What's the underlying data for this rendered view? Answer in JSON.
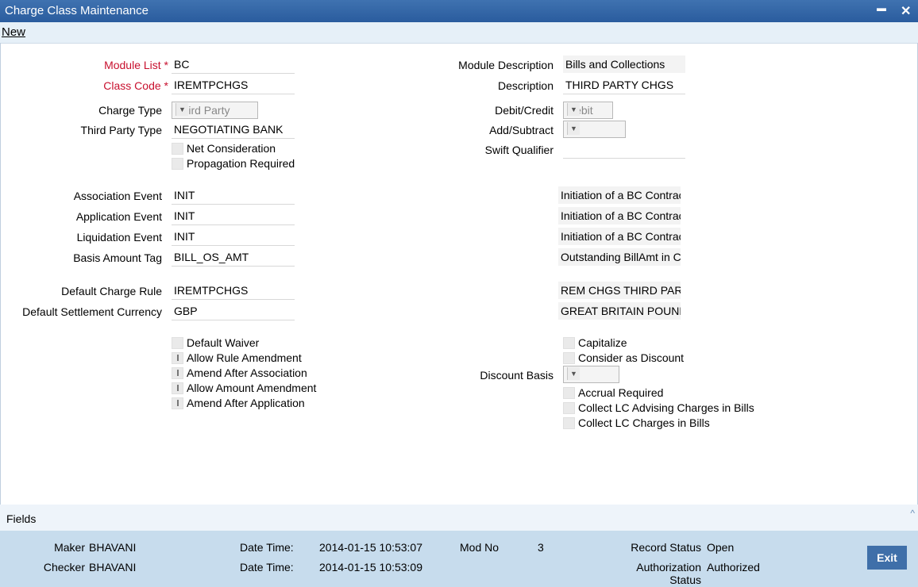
{
  "window": {
    "title": "Charge Class Maintenance",
    "minimize": "▬",
    "close": "✕"
  },
  "menu": {
    "new_label": "New"
  },
  "left": {
    "module_list": {
      "label": "Module List",
      "req": "*",
      "value": "BC"
    },
    "class_code": {
      "label": "Class Code",
      "req": "*",
      "value": "IREMTPCHGS"
    },
    "charge_type": {
      "label": "Charge Type",
      "value": "Third Party"
    },
    "third_party_type": {
      "label": "Third Party Type",
      "value": "NEGOTIATING BANK"
    },
    "net_consideration": "Net Consideration",
    "propagation_required": "Propagation Required",
    "association_event": {
      "label": "Association Event",
      "value": "INIT"
    },
    "application_event": {
      "label": "Application Event",
      "value": "INIT"
    },
    "liquidation_event": {
      "label": "Liquidation Event",
      "value": "INIT"
    },
    "basis_amount_tag": {
      "label": "Basis Amount Tag",
      "value": "BILL_OS_AMT"
    },
    "default_charge_rule": {
      "label": "Default Charge Rule",
      "value": "IREMTPCHGS"
    },
    "default_settlement_currency": {
      "label": "Default Settlement Currency",
      "value": "GBP"
    },
    "default_waiver": "Default Waiver",
    "allow_rule_amendment": "Allow Rule Amendment",
    "amend_after_association": "Amend After Association",
    "allow_amount_amendment": "Allow Amount Amendment",
    "amend_after_application": "Amend After Application"
  },
  "right": {
    "module_description": {
      "label": "Module Description",
      "value": "Bills and Collections"
    },
    "description": {
      "label": "Description",
      "value": "THIRD PARTY CHGS"
    },
    "debit_credit": {
      "label": "Debit/Credit",
      "value": "Debit"
    },
    "add_subtract": {
      "label": "Add/Subtract",
      "value": ""
    },
    "swift_qualifier": {
      "label": "Swift Qualifier",
      "value": ""
    },
    "association_desc": "Initiation of a BC Contract",
    "application_desc": "Initiation of a BC Contract",
    "liquidation_desc": "Initiation of a BC Contract",
    "basis_desc": "Outstanding BillAmt in Co",
    "charge_rule_desc": "REM CHGS THIRD PART",
    "currency_desc": "GREAT BRITAIN POUND",
    "capitalize": "Capitalize",
    "consider_as_discount": "Consider as Discount",
    "discount_basis": {
      "label": "Discount Basis",
      "value": ""
    },
    "accrual_required": "Accrual Required",
    "collect_lc_advising": "Collect LC Advising Charges in Bills",
    "collect_lc_charges": "Collect LC Charges in Bills"
  },
  "fields_bar": {
    "label": "Fields",
    "caret": "^"
  },
  "footer": {
    "maker_label": "Maker",
    "maker": "BHAVANI",
    "checker_label": "Checker",
    "checker": "BHAVANI",
    "date_time_label": "Date Time:",
    "maker_dt": "2014-01-15 10:53:07",
    "checker_dt": "2014-01-15 10:53:09",
    "mod_no_label": "Mod No",
    "mod_no": "3",
    "record_status_label": "Record Status",
    "record_status": "Open",
    "auth_status_label_1": "Authorization",
    "auth_status_label_2": "Status",
    "auth_status": "Authorized",
    "exit_label": "Exit"
  }
}
